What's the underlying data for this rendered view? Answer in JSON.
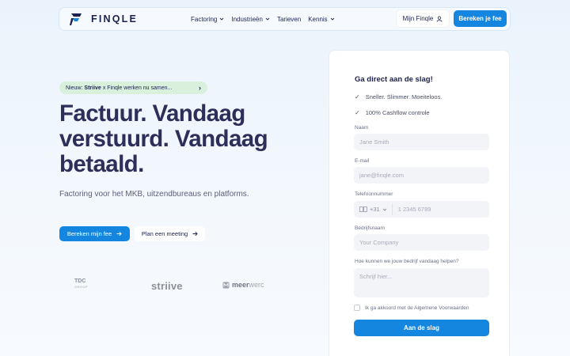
{
  "nav": {
    "brand": "FINQLE",
    "links": [
      {
        "label": "Factoring",
        "dropdown": true
      },
      {
        "label": "Industrieën",
        "dropdown": true
      },
      {
        "label": "Tarieven",
        "dropdown": false
      },
      {
        "label": "Kennis",
        "dropdown": true
      }
    ],
    "login_label": "Mijn Finqle",
    "cta_label": "Bereken je fee"
  },
  "hero": {
    "pill_prefix": "Nieuw:",
    "pill_highlight": "Striive",
    "pill_rest": "x Finqle werken nu samen...",
    "pill_icon": "chevron-right-icon",
    "headline": "Factuur. Vandaag verstuurd. Vandaag betaald.",
    "subline": "Factoring voor het MKB, uitzendbureaus en platforms.",
    "primary_button": "Bereken mijn fee",
    "secondary_button": "Plan een meeting"
  },
  "partners": {
    "tdc": "TDC",
    "tdc_sub": "GROUP",
    "striive": "striive",
    "meerwerc_bold": "meer",
    "meerwerc_light": "werc"
  },
  "form": {
    "title": "Ga direct aan de slag!",
    "checks": [
      "Sneller. Slimmer. Moeiteloos.",
      "100% Cashflow controle"
    ],
    "name_label": "Naam",
    "name_placeholder": "Jane Smith",
    "email_label": "E-mail",
    "email_placeholder": "jane@finqle.com",
    "phone_label": "Telefoonnummer",
    "phone_prefix": "+31",
    "phone_placeholder": "1 2345 6789",
    "company_label": "Bedrijfsnaam",
    "company_placeholder": "Your Company",
    "help_label": "Hoe kunnen we jouw bedrijf vandaag helpen?",
    "help_placeholder": "Schrijf hier...",
    "consent_label": "Ik ga akkoord met de Algemene Voorwaarden",
    "submit_label": "Aan de slag"
  },
  "colors": {
    "accent": "#1486e0",
    "headline": "#2b2f5a",
    "pill_bg": "#d9f1dc"
  }
}
